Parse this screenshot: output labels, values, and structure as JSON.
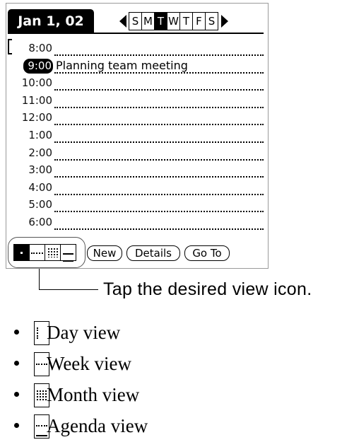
{
  "header": {
    "date_label": "Jan 1, 02",
    "week_days": [
      {
        "label": "S",
        "selected": false
      },
      {
        "label": "M",
        "selected": false
      },
      {
        "label": "T",
        "selected": true
      },
      {
        "label": "W",
        "selected": false
      },
      {
        "label": "T",
        "selected": false
      },
      {
        "label": "F",
        "selected": false
      },
      {
        "label": "S",
        "selected": false
      }
    ],
    "prev_icon": "triangle-left-icon",
    "next_icon": "triangle-right-icon"
  },
  "schedule": {
    "slots": [
      {
        "time": "8:00",
        "text": ""
      },
      {
        "time": "9:00",
        "text": "Planning team meeting",
        "current": true
      },
      {
        "time": "10:00",
        "text": ""
      },
      {
        "time": "11:00",
        "text": ""
      },
      {
        "time": "12:00",
        "text": ""
      },
      {
        "time": "1:00",
        "text": ""
      },
      {
        "time": "2:00",
        "text": ""
      },
      {
        "time": "3:00",
        "text": ""
      },
      {
        "time": "4:00",
        "text": ""
      },
      {
        "time": "5:00",
        "text": ""
      },
      {
        "time": "6:00",
        "text": ""
      }
    ]
  },
  "toolbar": {
    "view_icons": [
      "day-view-icon",
      "week-view-icon",
      "month-view-icon",
      "agenda-view-icon"
    ],
    "new_label": "New",
    "details_label": "Details",
    "goto_label": "Go To"
  },
  "callout": {
    "text": "Tap the desired view icon."
  },
  "legend": {
    "items": [
      {
        "icon": "day-view-icon",
        "label": "Day view"
      },
      {
        "icon": "week-view-icon",
        "label": "Week view"
      },
      {
        "icon": "month-view-icon",
        "label": "Month view"
      },
      {
        "icon": "agenda-view-icon",
        "label": "Agenda view"
      }
    ]
  }
}
